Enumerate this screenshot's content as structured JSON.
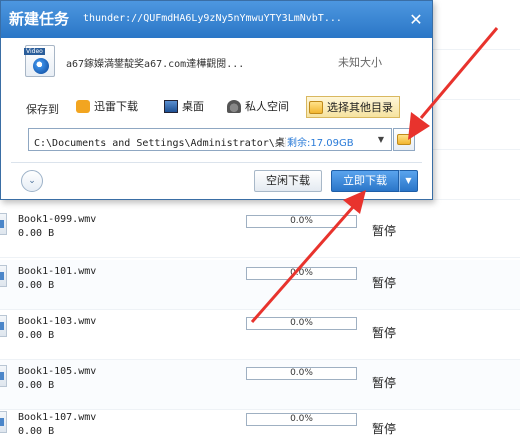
{
  "dialog": {
    "title": "新建任务",
    "url": "thunder://QUFmdHA6Ly9zNy5nYmwuYTY3LmNvbT...",
    "close_label": "✕",
    "file_name": "a67鎵嬫満鐢靛奖a67.com達樺觀閱...",
    "file_size": "未知大小",
    "video_badge": "Video",
    "save_to_label": "保存到",
    "locations": [
      {
        "label": "迅雷下载",
        "icon": "xunlei-icon"
      },
      {
        "label": "桌面",
        "icon": "desktop-icon"
      },
      {
        "label": "私人空间",
        "icon": "private-space-icon"
      },
      {
        "label": "选择其他目录",
        "icon": "folder-icon"
      }
    ],
    "path": "C:\\Documents and Settings\\Administrator\\桌面",
    "free_space": "剩余:17.09GB",
    "expand_glyph": "⌄",
    "idle_download_label": "空闲下载",
    "download_now_label": "立即下载",
    "dropdown_glyph": "▼"
  },
  "downloads": [
    {
      "name": "Book1-099.wmv",
      "size": "0.00 B",
      "progress_label": "0.0%",
      "progress": 0,
      "action": "暂停"
    },
    {
      "name": "Book1-101.wmv",
      "size": "0.00 B",
      "progress_label": "0.0%",
      "progress": 0,
      "action": "暂停"
    },
    {
      "name": "Book1-103.wmv",
      "size": "0.00 B",
      "progress_label": "0.0%",
      "progress": 0,
      "action": "暂停"
    },
    {
      "name": "Book1-105.wmv",
      "size": "0.00 B",
      "progress_label": "0.0%",
      "progress": 0,
      "action": "暂停"
    },
    {
      "name": "Book1-107.wmv",
      "size": "0.00 B",
      "progress_label": "0.0%",
      "progress": 0,
      "action": "暂停"
    }
  ],
  "colors": {
    "title_bar": "#2a76c6",
    "accent": "#2a75c8",
    "annotation_arrow": "#e8332d",
    "free_space_text": "#2a7bd8"
  }
}
